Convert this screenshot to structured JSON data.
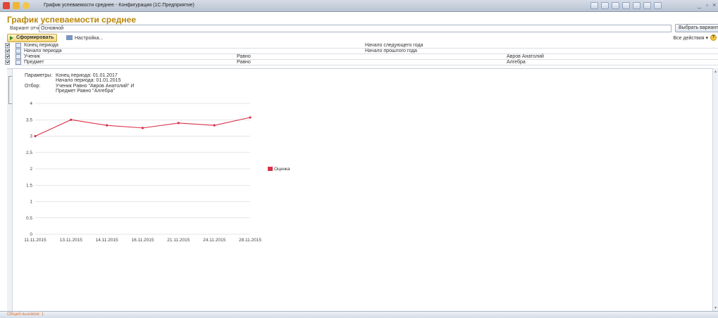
{
  "window": {
    "title": "График успеваемости среднее - Конфигурация  (1С:Предприятие)"
  },
  "page": {
    "title": "График успеваемости среднее"
  },
  "variant": {
    "label": "Вариант отчета:",
    "value": "Основной",
    "choose_button": "Выбрать вариант..."
  },
  "toolbar": {
    "generate_label": "Сформировать",
    "settings_label": "Настройка...",
    "all_actions_label": "Все действия ▾"
  },
  "filters": [
    {
      "name": "Конец периода",
      "condition": "",
      "value": "Начало следующего года",
      "value2": "",
      "checked": true
    },
    {
      "name": "Начало периода",
      "condition": "",
      "value": "Начало прошлого года",
      "value2": "",
      "checked": true
    },
    {
      "name": "Ученик",
      "condition": "Равно",
      "value": "",
      "value2": "Авров Анатолий",
      "checked": true
    },
    {
      "name": "Предмет",
      "condition": "Равно",
      "value": "",
      "value2": "Алгебра",
      "checked": true
    }
  ],
  "params": {
    "params_label": "Параметры:",
    "end_period": "Конец периода: 01.01.2017",
    "start_period": "Начало периода: 01.01.2015",
    "filter_label": "Отбор:",
    "filter_line1": "Ученик Равно \"Авров Анатолий\" И",
    "filter_line2": "Предмет Равно \"Алгебра\""
  },
  "status": {
    "tab_label": "Общий вызовом: 1"
  },
  "colors": {
    "series": "#d9304a",
    "title": "#b8860b"
  },
  "chart_data": {
    "type": "line",
    "title": "",
    "xlabel": "",
    "ylabel": "",
    "x": [
      "11.11.2015",
      "13.11.2015",
      "14.11.2015",
      "16.11.2015",
      "21.11.2015",
      "24.11.2015",
      "28.11.2015"
    ],
    "series": [
      {
        "name": "Оценка",
        "values": [
          3.0,
          3.5,
          3.33,
          3.25,
          3.4,
          3.33,
          3.57
        ]
      }
    ],
    "yticks": [
      "0",
      "0.5",
      "1",
      "1.5",
      "2",
      "2.5",
      "3",
      "3.5",
      "4"
    ],
    "ylim": [
      0,
      4
    ],
    "grid": true,
    "legend": "right"
  }
}
